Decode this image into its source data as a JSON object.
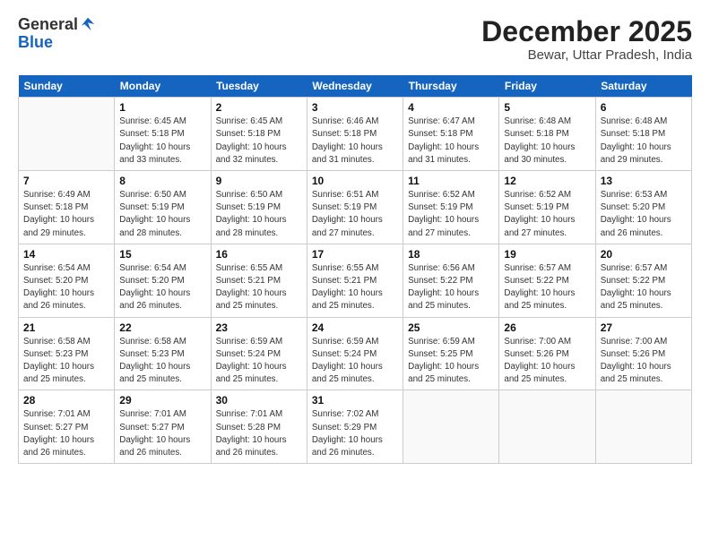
{
  "header": {
    "logo_general": "General",
    "logo_blue": "Blue",
    "month_title": "December 2025",
    "location": "Bewar, Uttar Pradesh, India"
  },
  "days_of_week": [
    "Sunday",
    "Monday",
    "Tuesday",
    "Wednesday",
    "Thursday",
    "Friday",
    "Saturday"
  ],
  "weeks": [
    [
      null,
      {
        "day": 1,
        "sunrise": "6:45 AM",
        "sunset": "5:18 PM",
        "daylight": "10 hours and 33 minutes."
      },
      {
        "day": 2,
        "sunrise": "6:45 AM",
        "sunset": "5:18 PM",
        "daylight": "10 hours and 32 minutes."
      },
      {
        "day": 3,
        "sunrise": "6:46 AM",
        "sunset": "5:18 PM",
        "daylight": "10 hours and 31 minutes."
      },
      {
        "day": 4,
        "sunrise": "6:47 AM",
        "sunset": "5:18 PM",
        "daylight": "10 hours and 31 minutes."
      },
      {
        "day": 5,
        "sunrise": "6:48 AM",
        "sunset": "5:18 PM",
        "daylight": "10 hours and 30 minutes."
      },
      {
        "day": 6,
        "sunrise": "6:48 AM",
        "sunset": "5:18 PM",
        "daylight": "10 hours and 29 minutes."
      }
    ],
    [
      {
        "day": 7,
        "sunrise": "6:49 AM",
        "sunset": "5:18 PM",
        "daylight": "10 hours and 29 minutes."
      },
      {
        "day": 8,
        "sunrise": "6:50 AM",
        "sunset": "5:19 PM",
        "daylight": "10 hours and 28 minutes."
      },
      {
        "day": 9,
        "sunrise": "6:50 AM",
        "sunset": "5:19 PM",
        "daylight": "10 hours and 28 minutes."
      },
      {
        "day": 10,
        "sunrise": "6:51 AM",
        "sunset": "5:19 PM",
        "daylight": "10 hours and 27 minutes."
      },
      {
        "day": 11,
        "sunrise": "6:52 AM",
        "sunset": "5:19 PM",
        "daylight": "10 hours and 27 minutes."
      },
      {
        "day": 12,
        "sunrise": "6:52 AM",
        "sunset": "5:19 PM",
        "daylight": "10 hours and 27 minutes."
      },
      {
        "day": 13,
        "sunrise": "6:53 AM",
        "sunset": "5:20 PM",
        "daylight": "10 hours and 26 minutes."
      }
    ],
    [
      {
        "day": 14,
        "sunrise": "6:54 AM",
        "sunset": "5:20 PM",
        "daylight": "10 hours and 26 minutes."
      },
      {
        "day": 15,
        "sunrise": "6:54 AM",
        "sunset": "5:20 PM",
        "daylight": "10 hours and 26 minutes."
      },
      {
        "day": 16,
        "sunrise": "6:55 AM",
        "sunset": "5:21 PM",
        "daylight": "10 hours and 25 minutes."
      },
      {
        "day": 17,
        "sunrise": "6:55 AM",
        "sunset": "5:21 PM",
        "daylight": "10 hours and 25 minutes."
      },
      {
        "day": 18,
        "sunrise": "6:56 AM",
        "sunset": "5:22 PM",
        "daylight": "10 hours and 25 minutes."
      },
      {
        "day": 19,
        "sunrise": "6:57 AM",
        "sunset": "5:22 PM",
        "daylight": "10 hours and 25 minutes."
      },
      {
        "day": 20,
        "sunrise": "6:57 AM",
        "sunset": "5:22 PM",
        "daylight": "10 hours and 25 minutes."
      }
    ],
    [
      {
        "day": 21,
        "sunrise": "6:58 AM",
        "sunset": "5:23 PM",
        "daylight": "10 hours and 25 minutes."
      },
      {
        "day": 22,
        "sunrise": "6:58 AM",
        "sunset": "5:23 PM",
        "daylight": "10 hours and 25 minutes."
      },
      {
        "day": 23,
        "sunrise": "6:59 AM",
        "sunset": "5:24 PM",
        "daylight": "10 hours and 25 minutes."
      },
      {
        "day": 24,
        "sunrise": "6:59 AM",
        "sunset": "5:24 PM",
        "daylight": "10 hours and 25 minutes."
      },
      {
        "day": 25,
        "sunrise": "6:59 AM",
        "sunset": "5:25 PM",
        "daylight": "10 hours and 25 minutes."
      },
      {
        "day": 26,
        "sunrise": "7:00 AM",
        "sunset": "5:26 PM",
        "daylight": "10 hours and 25 minutes."
      },
      {
        "day": 27,
        "sunrise": "7:00 AM",
        "sunset": "5:26 PM",
        "daylight": "10 hours and 25 minutes."
      }
    ],
    [
      {
        "day": 28,
        "sunrise": "7:01 AM",
        "sunset": "5:27 PM",
        "daylight": "10 hours and 26 minutes."
      },
      {
        "day": 29,
        "sunrise": "7:01 AM",
        "sunset": "5:27 PM",
        "daylight": "10 hours and 26 minutes."
      },
      {
        "day": 30,
        "sunrise": "7:01 AM",
        "sunset": "5:28 PM",
        "daylight": "10 hours and 26 minutes."
      },
      {
        "day": 31,
        "sunrise": "7:02 AM",
        "sunset": "5:29 PM",
        "daylight": "10 hours and 26 minutes."
      },
      null,
      null,
      null
    ]
  ]
}
